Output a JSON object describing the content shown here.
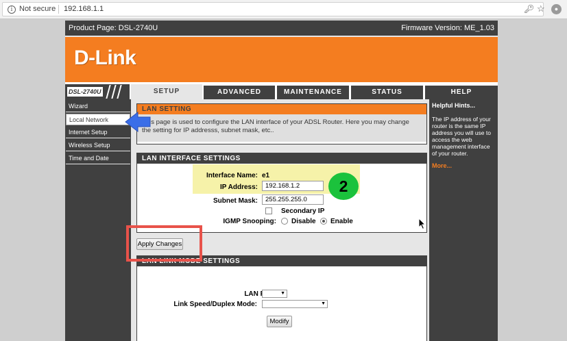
{
  "browser": {
    "security_label": "Not secure",
    "url": "192.168.1.1"
  },
  "header": {
    "product_page": "Product Page: DSL-2740U",
    "firmware": "Firmware Version: ME_1.03",
    "logo_text": "D-Link",
    "model_label": "DSL-2740U"
  },
  "nav": {
    "tabs": [
      {
        "label": "SETUP"
      },
      {
        "label": "ADVANCED"
      },
      {
        "label": "MAINTENANCE"
      },
      {
        "label": "STATUS"
      },
      {
        "label": "HELP"
      }
    ],
    "active_tab": "SETUP"
  },
  "sidebar": {
    "items": [
      {
        "label": "Wizard"
      },
      {
        "label": "Local Network"
      },
      {
        "label": "Internet Setup"
      },
      {
        "label": "Wireless Setup"
      },
      {
        "label": "Time and Date"
      }
    ],
    "active_item": "Local Network"
  },
  "lan_setting": {
    "title": "LAN SETTING",
    "description": "This page is used to configure the LAN interface of your ADSL Router. Here you may change the setting for IP addresss, subnet mask, etc.."
  },
  "lan_interface": {
    "title": "LAN INTERFACE SETTINGS",
    "interface_name_label": "Interface Name:",
    "interface_name_value": "e1",
    "ip_label": "IP Address:",
    "ip_value": "192.168.1.2",
    "mask_label": "Subnet Mask:",
    "mask_value": "255.255.255.0",
    "secondary_ip_label": "Secondary IP",
    "secondary_ip_checked": false,
    "igmp_label": "IGMP Snooping:",
    "igmp_disable_label": "Disable",
    "igmp_enable_label": "Enable",
    "igmp_selected": "Enable"
  },
  "apply_button": "Apply Changes",
  "link_mode": {
    "title": "LAN LINK MODE SETTINGS",
    "lan_port_label": "LAN Port:",
    "link_speed_label": "Link Speed/Duplex Mode:",
    "modify_button": "Modify"
  },
  "hints": {
    "title": "Helpful Hints...",
    "body": "The IP address of your router is the same IP address you will use to access the web management interface of your router.",
    "more": "More..."
  },
  "annotation": {
    "step_number": "2",
    "highlight_color": "#f4f09a",
    "box_color": "#e8524a",
    "badge_color": "#1bc23c",
    "arrow_color": "#3a6ee8"
  },
  "colors": {
    "brand_orange": "#f47d20",
    "dark_gray": "#404040"
  },
  "icons": [
    "info-icon",
    "key-icon",
    "star-icon",
    "extension-icon",
    "mouse-cursor-icon",
    "pointer-arrow-icon"
  ]
}
